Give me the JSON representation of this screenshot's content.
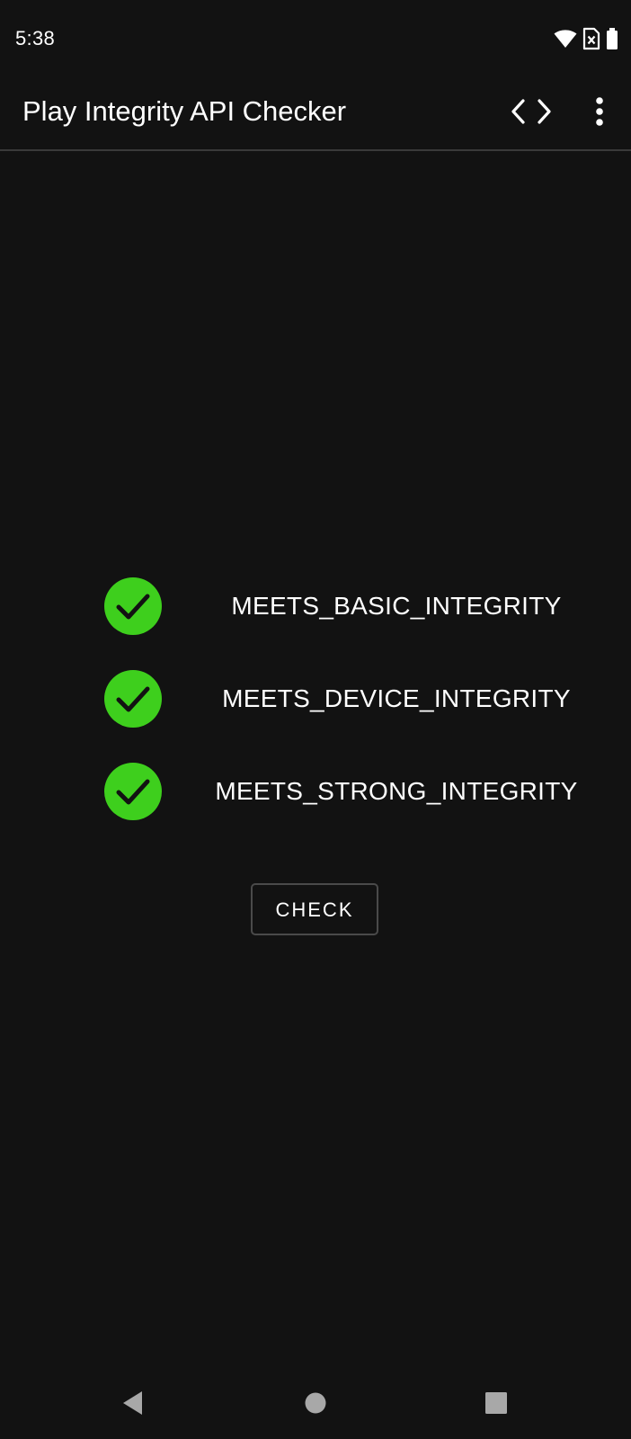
{
  "status_bar": {
    "time": "5:38",
    "icons": [
      "wifi-icon",
      "sim-card-icon",
      "battery-icon"
    ]
  },
  "app_bar": {
    "title": "Play Integrity API Checker",
    "actions": [
      "code-icon",
      "more-vert-icon"
    ]
  },
  "checks": [
    {
      "label": "MEETS_BASIC_INTEGRITY",
      "passed": true,
      "icon": "check-circle-icon"
    },
    {
      "label": "MEETS_DEVICE_INTEGRITY",
      "passed": true,
      "icon": "check-circle-icon"
    },
    {
      "label": "MEETS_STRONG_INTEGRITY",
      "passed": true,
      "icon": "check-circle-icon"
    }
  ],
  "check_button": {
    "label": "CHECK"
  },
  "navigation": {
    "buttons": [
      "back-icon",
      "home-icon",
      "recents-icon"
    ]
  },
  "colors": {
    "background": "#121212",
    "pass_green": "#3ecf1d",
    "divider": "#3a3a3a"
  }
}
